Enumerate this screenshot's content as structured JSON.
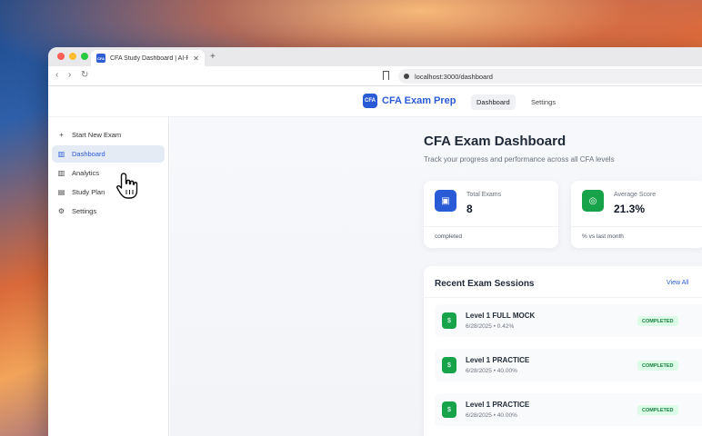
{
  "browser": {
    "tab_title": "CFA Study Dashboard | AI-Pro",
    "favicon_text": "CFA",
    "url": "localhost:3000/dashboard"
  },
  "header": {
    "logo_text": "CFA",
    "brand": "CFA Exam Prep",
    "nav": [
      "Dashboard",
      "Settings"
    ]
  },
  "sidebar": {
    "items": [
      {
        "label": "Start New Exam",
        "icon": "plus-icon",
        "active": false
      },
      {
        "label": "Dashboard",
        "icon": "bar-chart-icon",
        "active": true
      },
      {
        "label": "Analytics",
        "icon": "bar-chart-icon",
        "active": false
      },
      {
        "label": "Study Plan",
        "icon": "book-icon",
        "active": false
      },
      {
        "label": "Settings",
        "icon": "gear-icon",
        "active": false
      }
    ]
  },
  "main": {
    "title": "CFA Exam Dashboard",
    "subtitle": "Track your progress and performance across all CFA levels",
    "stats": [
      {
        "label": "Total Exams",
        "value": "8",
        "footer": "completed",
        "icon": "clipboard-icon",
        "color": "#2a5bd7"
      },
      {
        "label": "Average Score",
        "value": "21.3%",
        "footer": "% vs last month",
        "icon": "target-icon",
        "color": "#16a34a"
      }
    ],
    "sessions": {
      "title": "Recent Exam Sessions",
      "view_all": "View All",
      "rows": [
        {
          "name": "Level 1 FULL MOCK",
          "meta": "6/28/2025 • 0.42%",
          "status": "COMPLETED",
          "icon": "dollar-icon"
        },
        {
          "name": "Level 1 PRACTICE",
          "meta": "6/28/2025 • 40.00%",
          "status": "COMPLETED",
          "icon": "dollar-icon"
        },
        {
          "name": "Level 1 PRACTICE",
          "meta": "6/28/2025 • 40.00%",
          "status": "COMPLETED",
          "icon": "dollar-icon"
        }
      ]
    }
  }
}
